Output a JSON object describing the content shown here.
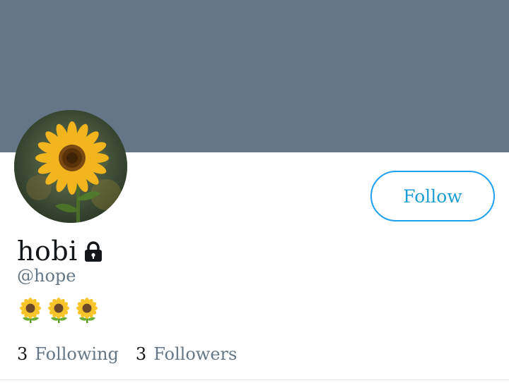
{
  "profile": {
    "display_name": "hobi",
    "handle": "@hope",
    "protected_icon": "lock-icon",
    "bio_icons": [
      "sunflower-icon",
      "sunflower-icon",
      "sunflower-icon"
    ],
    "follow_label": "Follow",
    "stats": [
      {
        "count": "3",
        "label": "Following"
      },
      {
        "count": "3",
        "label": "Followers"
      }
    ]
  },
  "colors": {
    "banner": "#657786",
    "accent": "#1da1f2",
    "text_primary": "#14171a",
    "text_secondary": "#657786"
  }
}
